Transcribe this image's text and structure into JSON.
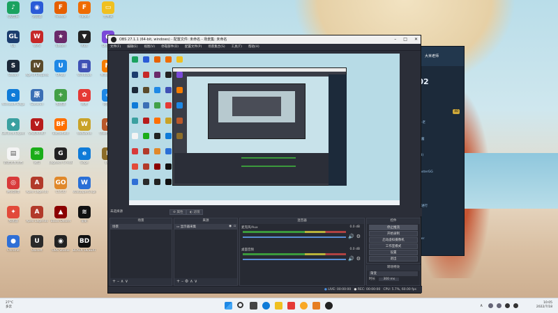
{
  "desktop_icons": [
    {
      "label": "QQ音乐",
      "color": "#1aa260",
      "glyph": "♪"
    },
    {
      "label": "GL",
      "color": "#1c3d6e",
      "glyph": "GL"
    },
    {
      "label": "Steam",
      "color": "#1b2838",
      "glyph": "S"
    },
    {
      "label": "Microsoft Edge",
      "color": "#0f7bd8",
      "glyph": "e"
    },
    {
      "label": "GeForce Experience",
      "color": "#3aa0a0",
      "glyph": "◆"
    },
    {
      "label": "新建文本文档",
      "color": "#f4f4f4",
      "glyph": "▤"
    },
    {
      "label": "腾讯游戏",
      "color": "#d83a3a",
      "glyph": "◎"
    },
    {
      "label": "加速器",
      "color": "#e24a3a",
      "glyph": "✦"
    },
    {
      "label": "Chrome",
      "color": "#2f6fd6",
      "glyph": "●"
    },
    {
      "label": "浏览器",
      "color": "#2a5bd7",
      "glyph": "◉"
    },
    {
      "label": "WPS",
      "color": "#c62828",
      "glyph": "W"
    },
    {
      "label": "Age of Empires IV",
      "color": "#5a4a2a",
      "glyph": "IV"
    },
    {
      "label": "Genshin",
      "color": "#3b6fb5",
      "glyph": "原"
    },
    {
      "label": "VALORANT",
      "color": "#b71c1c",
      "glyph": "V"
    },
    {
      "label": "微信",
      "color": "#1aad19",
      "glyph": "✉"
    },
    {
      "label": "Apex Legends",
      "color": "#b23a2a",
      "glyph": "A"
    },
    {
      "label": "Apex Legends",
      "color": "#b23a2a",
      "glyph": "A"
    },
    {
      "label": "Ubisoft",
      "color": "#2a2a2a",
      "glyph": "U"
    },
    {
      "label": "Firefox",
      "color": "#e66000",
      "glyph": "F"
    },
    {
      "label": "Steam",
      "color": "#6a2a6a",
      "glyph": "★"
    },
    {
      "label": "UPlay",
      "color": "#1e88e5",
      "glyph": "U"
    },
    {
      "label": "加速器",
      "color": "#43a047",
      "glyph": "+"
    },
    {
      "label": "Battlefield",
      "color": "#ff6f00",
      "glyph": "BF"
    },
    {
      "label": "Logitech G HUB",
      "color": "#222222",
      "glyph": "G"
    },
    {
      "label": "CS:GO",
      "color": "#e0882a",
      "glyph": "GO"
    },
    {
      "label": "Black Desert",
      "color": "#8b0000",
      "glyph": "▲"
    },
    {
      "label": "OBS Studio",
      "color": "#222222",
      "glyph": "◉"
    },
    {
      "label": "Faceit",
      "color": "#ef6c00",
      "glyph": "F"
    },
    {
      "label": "Riot",
      "color": "#222222",
      "glyph": "▼"
    },
    {
      "label": "Windows",
      "color": "#3f51b5",
      "glyph": "▦"
    },
    {
      "label": "网易",
      "color": "#e53935",
      "glyph": "✿"
    },
    {
      "label": "WeGame",
      "color": "#c9a227",
      "glyph": "W"
    },
    {
      "label": "Edge",
      "color": "#0f7bd8",
      "glyph": "e"
    },
    {
      "label": "WallpaperEngine",
      "color": "#2a6fd6",
      "glyph": "W"
    },
    {
      "label": "雷蛇",
      "color": "#111111",
      "glyph": "≋"
    },
    {
      "label": "BLACK DESERT",
      "color": "#111111",
      "glyph": "BD"
    },
    {
      "label": "文件夹",
      "color": "#f0c020",
      "glyph": "▭"
    },
    {
      "label": "Discord",
      "color": "#7a4ad8",
      "glyph": "◐"
    },
    {
      "label": "Minecraft",
      "color": "#f57c00",
      "glyph": "M"
    },
    {
      "label": "网易云",
      "color": "#1e88e5",
      "glyph": "◈"
    },
    {
      "label": "Overwatch",
      "color": "#b9582a",
      "glyph": "⊕"
    },
    {
      "label": "LOL",
      "color": "#8c6d2a",
      "glyph": "L"
    }
  ],
  "chat_app": {
    "header": "大米老师",
    "time": ":02",
    "lines": [
      "在线·老",
      "小温酱",
      "(378)",
      "monsterGG",
      "在世",
      "如何进行",
      "来自",
      "Hover"
    ],
    "badge": "40"
  },
  "obs": {
    "title": "OBS 27.1.1 (64-bit, windows) - 配置文件: 未命名 - 场景集: 未命名",
    "menu": [
      "文件(F)",
      "编辑(E)",
      "视图(V)",
      "停靠部件(D)",
      "配置文件(P)",
      "场景集合(S)",
      "工具(T)",
      "帮助(H)"
    ],
    "source_bar_label": "未选择源",
    "props_btn": "属性",
    "filters_btn": "滤镜",
    "docks": {
      "scenes": {
        "title": "场景",
        "items": [
          "场景"
        ]
      },
      "sources": {
        "title": "来源",
        "items": [
          "显示器采集"
        ]
      },
      "mixer": {
        "title": "混音器",
        "channels": [
          {
            "name": "麦克风/Aux",
            "db": "0.0 dB"
          },
          {
            "name": "桌面音频",
            "db": "0.0 dB"
          }
        ]
      },
      "transitions": {
        "title": "转场特效",
        "type": "渐变",
        "duration_label": "时长",
        "duration": "300 ms"
      },
      "controls": {
        "title": "控件",
        "buttons": [
          "停止推流",
          "开始录制",
          "启动虚拟摄像机",
          "工作室模式",
          "设置",
          "退出"
        ]
      }
    },
    "status": {
      "live": "LIVE: 00:00:00",
      "rec": "REC: 00:00:00",
      "cpu": "CPU: 5.7%, 60.00 fps"
    }
  },
  "taskbar": {
    "weather_temp": "27°C",
    "weather_desc": "多云",
    "time": "10:05",
    "date": "2022/7/18",
    "pinned": [
      "start",
      "search",
      "task-view",
      "edge",
      "explorer",
      "store",
      "chrome",
      "obs"
    ]
  }
}
